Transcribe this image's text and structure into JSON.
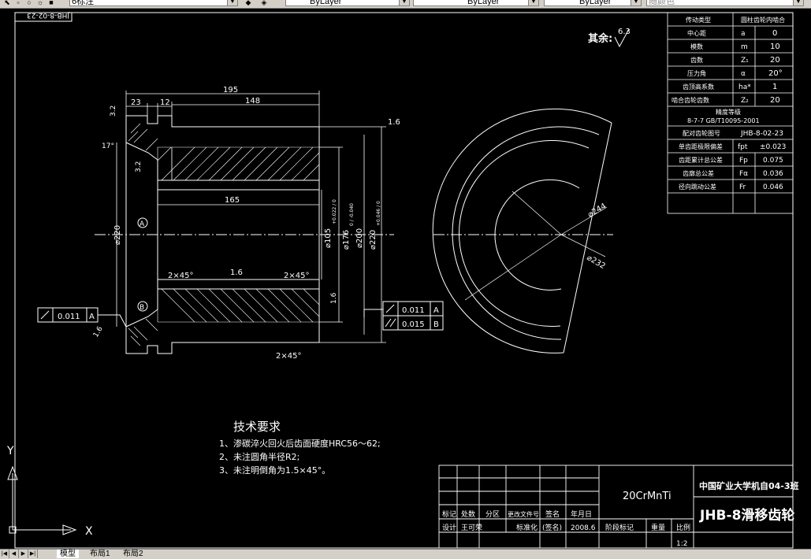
{
  "toolbar": {
    "dimstyle_value": "6标注",
    "layer_value": "ByLayer",
    "linetype_value": "ByLayer",
    "lineweight_value": "ByLayer",
    "color_value": "随颜色"
  },
  "drawing": {
    "corner_label": "JHB-8-02-23",
    "roughness_rest_label": "其余:",
    "roughness_rest_value": "6.3",
    "dims": {
      "d195": "195",
      "d148": "148",
      "d23": "23",
      "d12": "12",
      "d165": "165",
      "d3_2a": "3.2",
      "d3_2b": "3.2",
      "d17": "17°",
      "d1_6a": "1.6",
      "d1_6b": "1.6",
      "d1_6c": "1.6",
      "d1_6d": "1.6",
      "phi220_left": "⌀220",
      "phi105": "⌀105",
      "phi105_tol": "+0.022 / 0",
      "phi176": "⌀176",
      "phi176_tol": "0 / -0.040",
      "phi200": "⌀200",
      "phi220": "⌀220",
      "phi220_tol": "+0.046 / 0",
      "chamfer_a": "2×45°",
      "chamfer_b": "2×45°",
      "chamfer_c": "2×45°",
      "datum_a": "A",
      "datum_b": "B",
      "phi244": "⌀244",
      "phi232": "⌀232"
    },
    "tol_left": {
      "value": "0.011",
      "datum": "A"
    },
    "tol_right": [
      {
        "value": "0.011",
        "datum": "A"
      },
      {
        "value": "0.015",
        "datum": "B"
      }
    ],
    "tech_title": "技术要求",
    "tech_items": [
      "1、渗碳淬火回火后齿面硬度HRC56～62;",
      "2、未注圆角半径R2;",
      "3、未注明倒角为1.5×45°。"
    ]
  },
  "param_table": {
    "header": [
      "传动类型",
      "圆柱齿轮内啮合"
    ],
    "rows": [
      [
        "中心距",
        "a",
        "0"
      ],
      [
        "模数",
        "m",
        "10"
      ],
      [
        "齿数",
        "Z₁",
        "20"
      ],
      [
        "压力角",
        "α",
        "20°"
      ],
      [
        "齿顶高系数",
        "ha*",
        "1"
      ],
      [
        "啮合齿轮齿数",
        "Z₂",
        "20"
      ]
    ],
    "accuracy_title": "精度等级",
    "accuracy_value": "8-7-7 GB/T10095-2001",
    "rows2": [
      [
        "配对齿轮图号",
        "",
        "JHB-8-02-23"
      ],
      [
        "单齿距极限偏差",
        "fpt",
        "±0.023"
      ],
      [
        "齿距累计总公差",
        "Fp",
        "0.075"
      ],
      [
        "齿廓总公差",
        "Fα",
        "0.036"
      ],
      [
        "径向跳动公差",
        "Fr",
        "0.046"
      ]
    ]
  },
  "title_block": {
    "material": "20CrMnTi",
    "school": "中国矿业大学机自04-3班",
    "part_name": "JHB-8滑移齿轮",
    "row1": [
      "标记",
      "处数",
      "分区",
      "更改文件号",
      "签名",
      "年月日"
    ],
    "row2": [
      "设计",
      "王可荣",
      "",
      "标准化",
      "(签名)",
      "2008.6"
    ],
    "stage_label": "阶段标记",
    "weight_label": "重量",
    "scale_label": "比例",
    "scale_value": "1:2"
  },
  "ucs": {
    "x_label": "X",
    "y_label": "Y"
  },
  "tabs": {
    "model": "模型",
    "layout1": "布局1",
    "layout2": "布局2"
  }
}
